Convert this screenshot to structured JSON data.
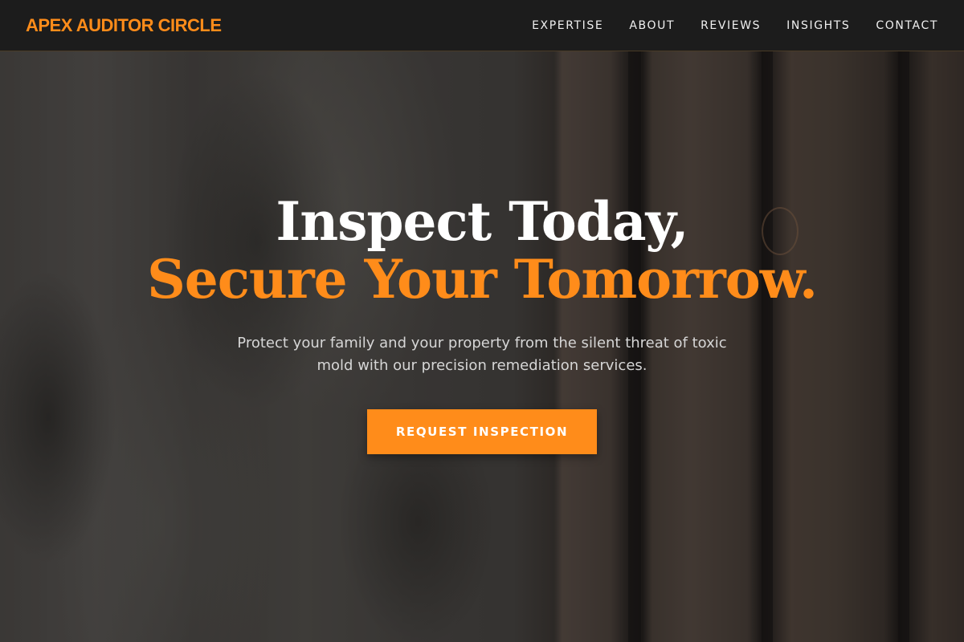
{
  "brand": {
    "name": "APEX AUDITOR CIRCLE"
  },
  "nav": {
    "items": [
      {
        "label": "EXPERTISE"
      },
      {
        "label": "ABOUT"
      },
      {
        "label": "REVIEWS"
      },
      {
        "label": "INSIGHTS"
      },
      {
        "label": "CONTACT"
      }
    ]
  },
  "hero": {
    "headline_line1": "Inspect Today,",
    "headline_line2": "Secure Your Tomorrow.",
    "subtitle": "Protect your family and your property from the silent threat of toxic mold with our precision remediation services.",
    "cta_label": "REQUEST INSPECTION"
  },
  "colors": {
    "accent": "#ff8c1a",
    "navbar_bg": "#1c1c1c",
    "text_light": "#ffffff"
  }
}
